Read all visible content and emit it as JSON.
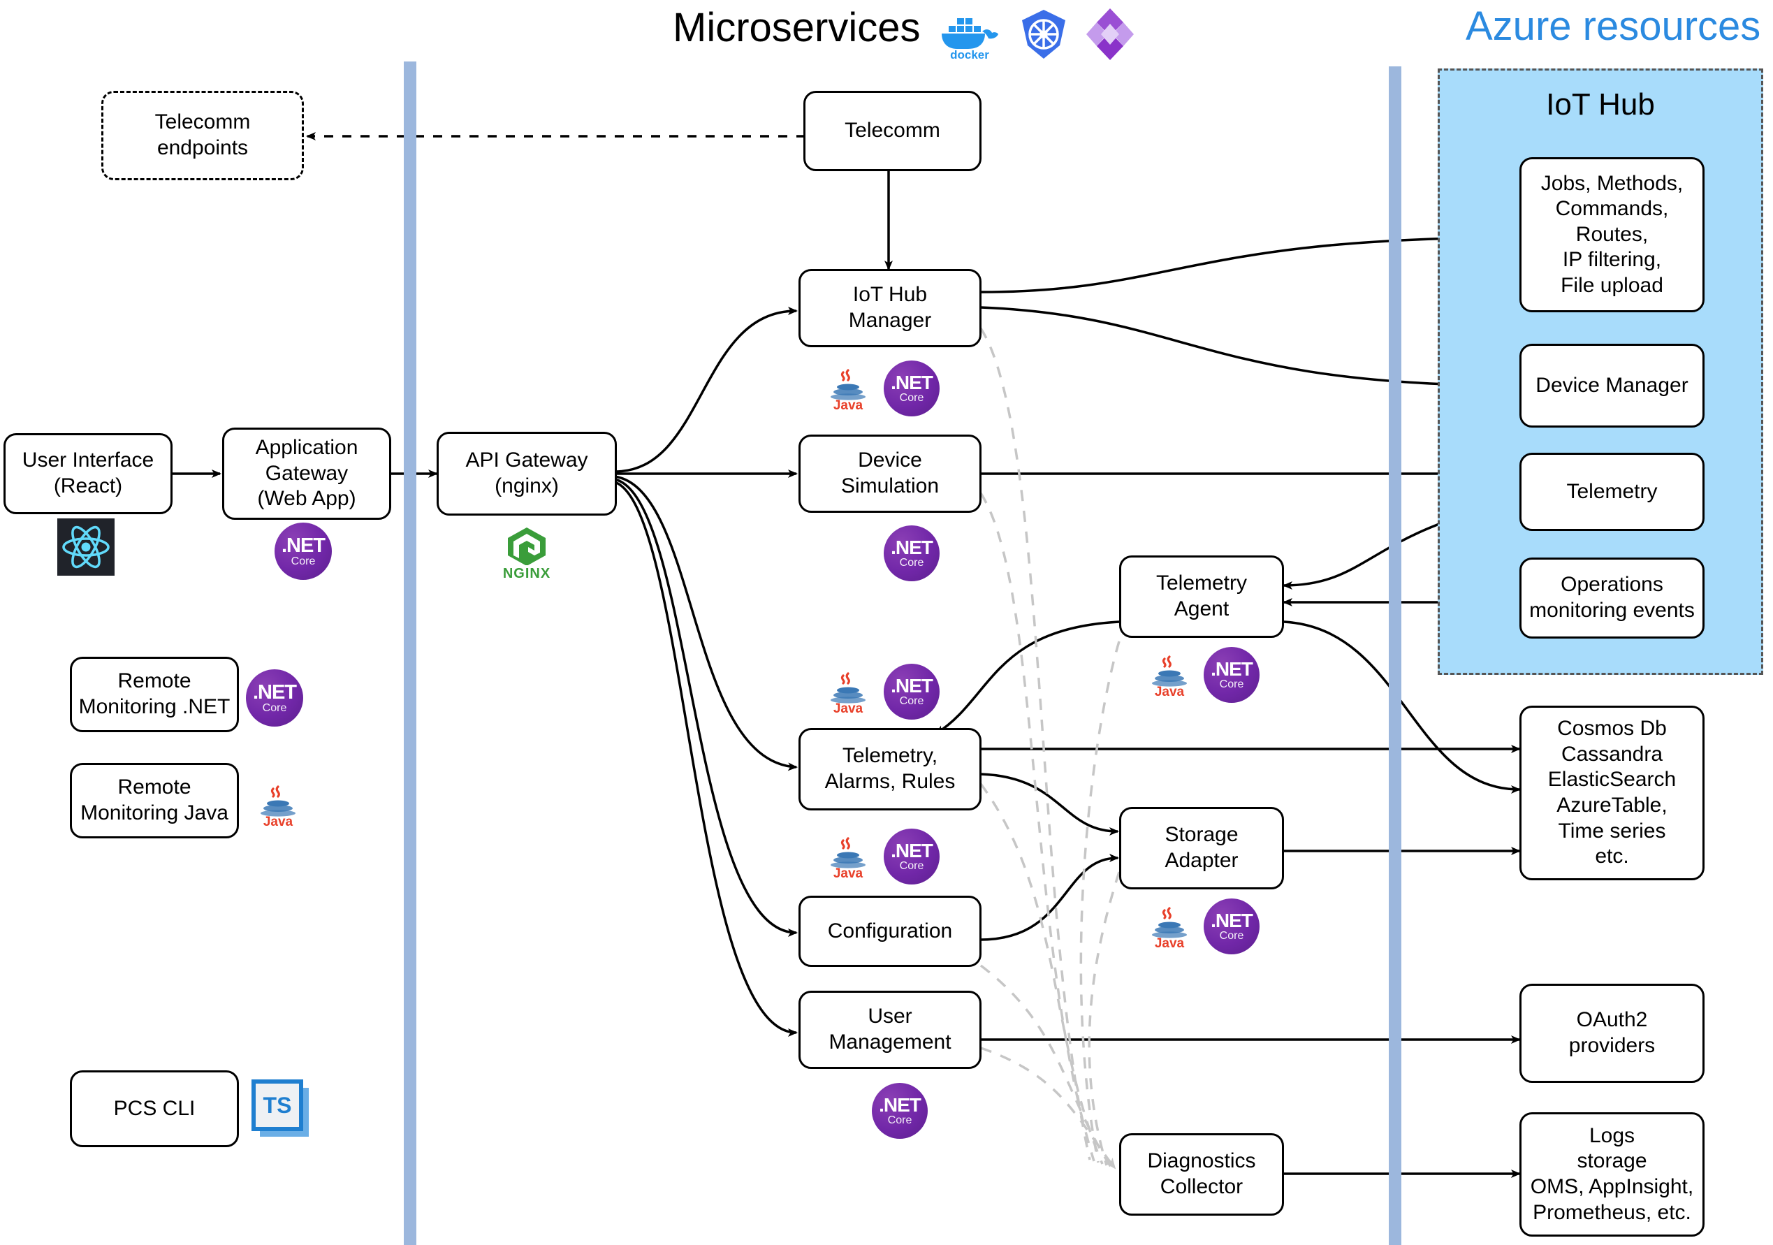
{
  "headers": {
    "microservices_title": "Microservices",
    "azure_title": "Azure resources",
    "iot_hub_panel": "IoT Hub"
  },
  "icons": {
    "docker": "docker-icon",
    "kubernetes": "kubernetes-icon",
    "service_fabric": "service-fabric-icon",
    "dotnet_top": ".NET",
    "dotnet_bottom": "Core",
    "java_word": "Java",
    "nginx_word": "NGINX",
    "ts_word": "TS",
    "react": "react-icon"
  },
  "colors": {
    "azure_blue": "#2b8ae0",
    "panel_fill": "#a8dcfb",
    "separator": "#9cb7dd",
    "dotnet_purple": "#7127a8",
    "java_red": "#e8402a",
    "nginx_green": "#3a9d3a",
    "ts_blue": "#1f7fd0",
    "dashed_gray": "#c6c6c6"
  },
  "nodes": {
    "telecomm_endpoints": "Telecomm\nendpoints",
    "telecomm": "Telecomm",
    "iot_hub_manager": "IoT Hub\nManager",
    "device_simulation": "Device\nSimulation",
    "telemetry_agent": "Telemetry\nAgent",
    "telemetry_alarms_rules": "Telemetry,\nAlarms, Rules",
    "storage_adapter": "Storage\nAdapter",
    "configuration": "Configuration",
    "user_management": "User\nManagement",
    "diagnostics_collector": "Diagnostics\nCollector",
    "user_interface": "User Interface\n(React)",
    "application_gateway": "Application\nGateway\n(Web App)",
    "api_gateway": "API Gateway\n(nginx)",
    "remote_monitoring_net": "Remote\nMonitoring .NET",
    "remote_monitoring_java": "Remote\nMonitoring Java",
    "pcs_cli": "PCS CLI"
  },
  "azure": {
    "jobs_methods": "Jobs, Methods,\nCommands,\nRoutes,\nIP filtering,\nFile upload",
    "device_manager": "Device Manager",
    "telemetry": "Telemetry",
    "operations_monitoring": "Operations\nmonitoring events",
    "cosmos": "Cosmos Db\nCassandra\nElasticSearch\nAzureTable,\nTime series\netc.",
    "oauth2": "OAuth2\nproviders",
    "logs": "Logs\nstorage\nOMS, AppInsight,\nPrometheus, etc."
  }
}
